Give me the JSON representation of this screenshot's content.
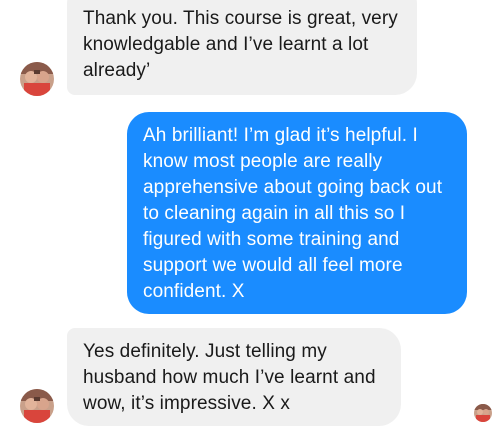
{
  "conversation": {
    "messages": [
      {
        "sender": "contact",
        "text": "Thank you. This course is great, very\nknowledgable and I’ve learnt a lot\nalready’"
      },
      {
        "sender": "me",
        "text": "Ah brilliant! I’m glad it’s helpful. I\nknow most people are really\napprehensive about going back out\nto cleaning again in all this so I\nfigured with some training and\nsupport we would all feel more\nconfident. X"
      },
      {
        "sender": "contact",
        "text": "Yes definitely. Just telling my\nhusband how much I’ve learnt and\nwow, it’s impressive. X x"
      }
    ]
  },
  "colors": {
    "incoming_bubble": "#f0f0f0",
    "outgoing_bubble": "#1a8cff",
    "incoming_text": "#1a1a1a",
    "outgoing_text": "#ffffff"
  },
  "icons": {
    "contact_avatar": "contact-avatar-icon",
    "read_receipt": "read-receipt-avatar-icon"
  }
}
